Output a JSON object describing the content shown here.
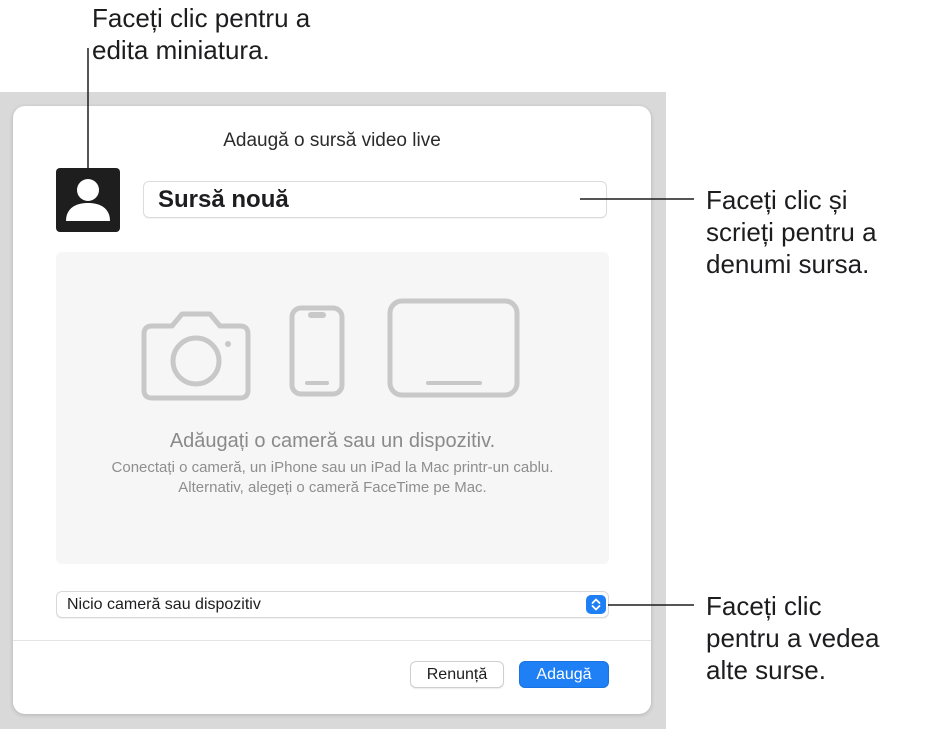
{
  "callouts": {
    "thumbnail": [
      "Faceți clic pentru a",
      "edita miniatura."
    ],
    "name": [
      "Faceți clic și",
      "scrieți pentru a",
      "denumi sursa."
    ],
    "source": [
      "Faceți clic",
      "pentru a vedea",
      "alte surse."
    ]
  },
  "dialog": {
    "title": "Adaugă o sursă video live",
    "thumbnail_icon": "person-icon",
    "name_value": "Sursă nouă",
    "empty_state": {
      "icons": [
        "camera-icon",
        "iphone-icon",
        "ipad-icon"
      ],
      "heading": "Adăugați o cameră sau un dispozitiv.",
      "body": "Conectați o cameră, un iPhone sau un iPad la Mac printr-un cablu. Alternativ, alegeți o cameră FaceTime pe Mac."
    },
    "source_select": {
      "value": "Nicio cameră sau dispozitiv",
      "icon": "up-down-chevron-icon"
    },
    "buttons": {
      "cancel": "Renunță",
      "add": "Adaugă"
    }
  },
  "colors": {
    "accent": "#1f7ff5",
    "backdrop": "#d9d9d9",
    "empty_area": "#f6f6f6"
  }
}
